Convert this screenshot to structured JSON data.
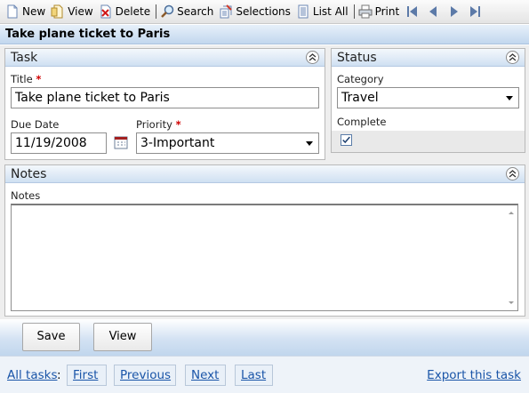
{
  "toolbar": {
    "new": "New",
    "view": "View",
    "delete": "Delete",
    "search": "Search",
    "selections": "Selections",
    "list_all": "List All",
    "print": "Print",
    "nav_icons": [
      "first-record-icon",
      "previous-record-icon",
      "next-record-icon",
      "last-record-icon"
    ]
  },
  "window": {
    "title": "Take plane ticket to Paris"
  },
  "task_panel": {
    "header": "Task",
    "title_label": "Title",
    "title_value": "Take plane ticket to Paris",
    "due_date_label": "Due Date",
    "due_date_value": "11/19/2008",
    "priority_label": "Priority",
    "priority_value": "3-Important",
    "required_marker": "*"
  },
  "status_panel": {
    "header": "Status",
    "category_label": "Category",
    "category_value": "Travel",
    "complete_label": "Complete",
    "complete_checked": true
  },
  "notes_panel": {
    "header": "Notes",
    "notes_label": "Notes",
    "notes_value": ""
  },
  "buttons": {
    "save": "Save",
    "view": "View"
  },
  "footer": {
    "all_tasks": "All tasks",
    "colon": ":",
    "first": "First",
    "previous": "Previous",
    "next": "Next",
    "last": "Last",
    "export": "Export this task"
  },
  "colors": {
    "accent_blue": "#c2d7ee",
    "link_blue": "#1a55a8",
    "required_red": "#d00000",
    "panel_bg": "#eeeeee"
  }
}
